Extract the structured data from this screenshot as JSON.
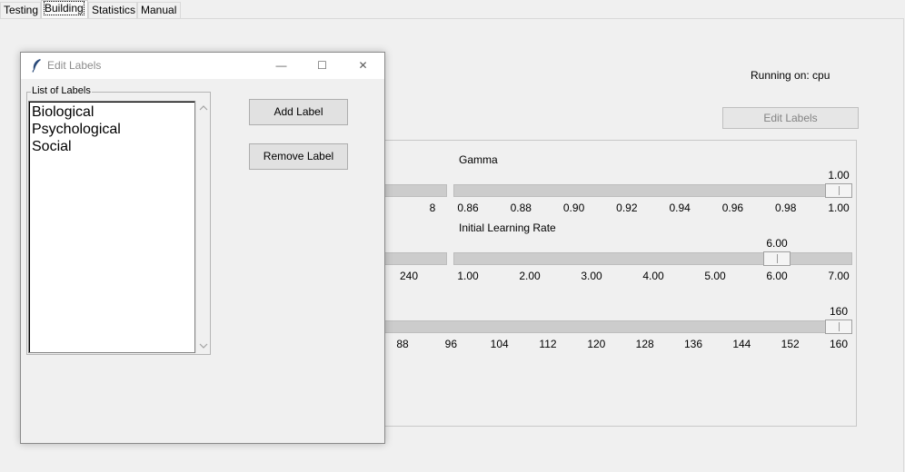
{
  "tabs": [
    "Testing",
    "Building",
    "Statistics",
    "Manual"
  ],
  "main": {
    "running_on": "Running on: cpu",
    "edit_labels_button": "Edit Labels",
    "gamma": {
      "label": "Gamma",
      "value_text": "1.00",
      "value": 1.0,
      "min": 0.85,
      "max": 1.0,
      "ticks": [
        "0.86",
        "0.88",
        "0.90",
        "0.92",
        "0.94",
        "0.96",
        "0.98",
        "1.00"
      ],
      "left_partial_tick": "8"
    },
    "learning_rate": {
      "label": "Initial Learning Rate",
      "value_text": "6.00",
      "value": 6.0,
      "min": 1.0,
      "max": 7.0,
      "ticks": [
        "1.00",
        "2.00",
        "3.00",
        "4.00",
        "5.00",
        "6.00",
        "7.00"
      ],
      "left_partial_tick": "240"
    },
    "third_slider": {
      "value_text": "160",
      "value": 160,
      "ticks": [
        "88",
        "96",
        "104",
        "112",
        "120",
        "128",
        "136",
        "144",
        "152",
        "160"
      ]
    }
  },
  "dialog": {
    "title": "Edit Labels",
    "minimize_glyph": "—",
    "maximize_glyph": "☐",
    "close_glyph": "✕",
    "group_title": "List of Labels",
    "labels": [
      "Biological",
      "Psychological",
      "Social"
    ],
    "add_button": "Add Label",
    "remove_button": "Remove Label"
  },
  "icons": {
    "dialog_icon": "feather-icon",
    "scroll_up": "chevron-up-icon",
    "scroll_down": "chevron-down-icon"
  }
}
